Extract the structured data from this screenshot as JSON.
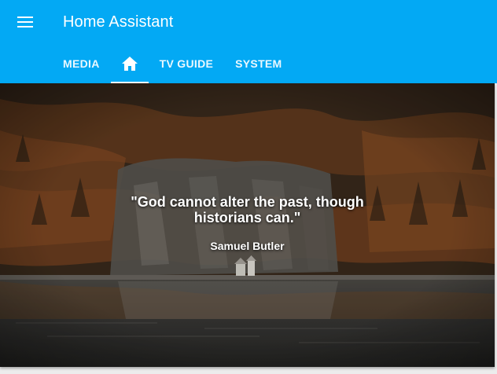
{
  "header": {
    "title": "Home Assistant",
    "menu_icon": "menu-icon",
    "background_color": "#03a9f4"
  },
  "tabs": [
    {
      "label": "MEDIA",
      "active": false
    },
    {
      "label": "",
      "icon": "home-icon",
      "active": true
    },
    {
      "label": "TV GUIDE",
      "active": false
    },
    {
      "label": "SYSTEM",
      "active": false
    }
  ],
  "quote_card": {
    "text": "\"God cannot alter the past, though historians can.\"",
    "author": "Samuel Butler",
    "background": "autumn forest cliff above a lake"
  }
}
